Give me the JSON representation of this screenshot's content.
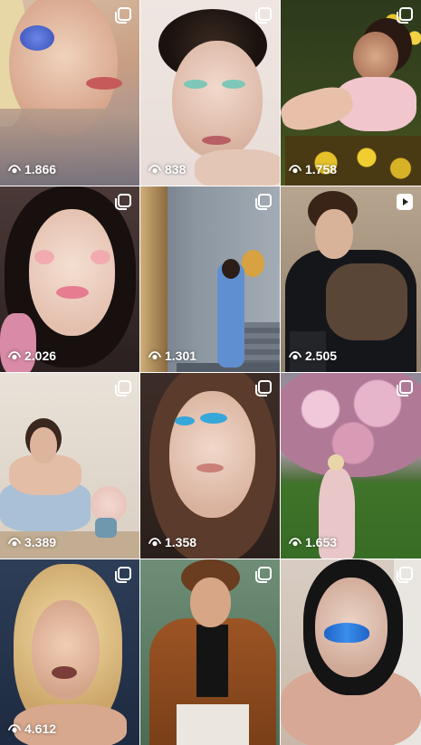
{
  "grid": {
    "tiles": [
      {
        "views": "1.866",
        "badge_icon": "carousel-icon"
      },
      {
        "views": "838",
        "badge_icon": "carousel-icon"
      },
      {
        "views": "1.758",
        "badge_icon": "carousel-icon"
      },
      {
        "views": "2.026",
        "badge_icon": "carousel-icon"
      },
      {
        "views": "1.301",
        "badge_icon": "carousel-icon"
      },
      {
        "views": "2.505",
        "badge_icon": "play-icon"
      },
      {
        "views": "3.389",
        "badge_icon": "carousel-icon"
      },
      {
        "views": "1.358",
        "badge_icon": "carousel-icon"
      },
      {
        "views": "1.653",
        "badge_icon": "carousel-icon"
      },
      {
        "views": "4.612",
        "badge_icon": "carousel-icon"
      },
      {
        "views": "",
        "badge_icon": "carousel-icon"
      },
      {
        "views": "",
        "badge_icon": "carousel-icon"
      }
    ]
  },
  "colors": {
    "overlay_text": "#ffffff",
    "background": "#ffffff"
  }
}
